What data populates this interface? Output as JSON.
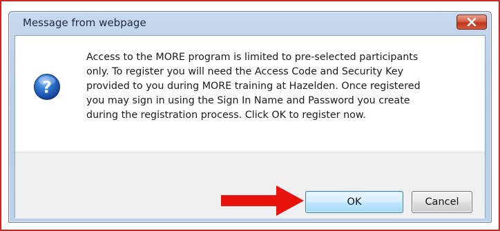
{
  "dialog": {
    "title": "Message from webpage",
    "close_icon": "close-icon",
    "icon": "question-icon",
    "message": "Access to the MORE program is limited to pre-selected participants\nonly. To register you will need the Access Code and Security Key\nprovided to you during MORE training at Hazelden. Once registered\nyou may sign in using the Sign In Name and Password you create\nduring the registration process. Click OK to register now.",
    "ok_label": "OK",
    "cancel_label": "Cancel"
  },
  "annotation": {
    "arrow_icon": "red-arrow-icon",
    "arrow_color": "#e8120c"
  },
  "colors": {
    "frame_border": "#c8281e",
    "close_button": "#c0351e",
    "question_icon": "#1f5fb4"
  }
}
